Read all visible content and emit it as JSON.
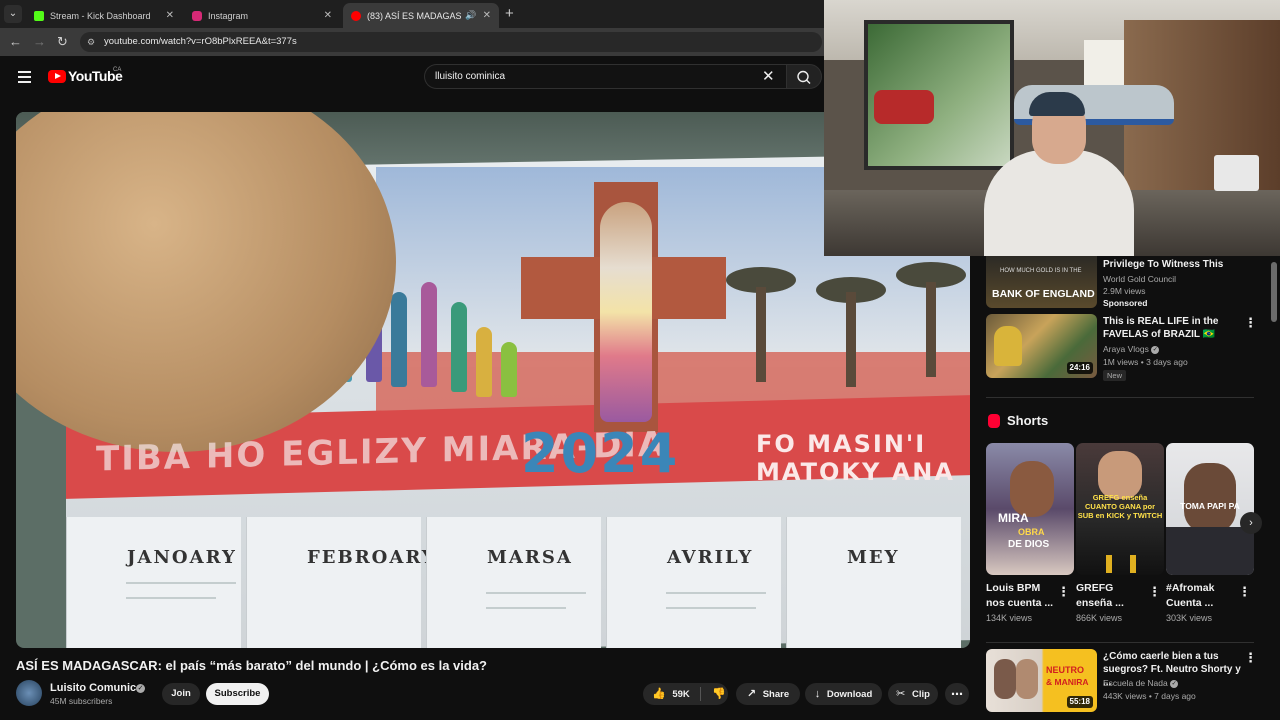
{
  "browser": {
    "tabs": [
      {
        "label": "Stream - Kick Dashboard",
        "color": "#53fc18"
      },
      {
        "label": "Instagram",
        "color": "#d62976"
      },
      {
        "label": "(83) ASÍ ES MADAGASCAR",
        "color": "#ff0000",
        "active": true
      }
    ],
    "url": "youtube.com/watch?v=rO8bPlxREEA&t=377s"
  },
  "youtube": {
    "logo_text": "YouTube",
    "region": "CA",
    "search_value": "lluisito cominica"
  },
  "video": {
    "calendar_texts": {
      "slogan": "TIBA HO EGLIZY MIARA-DIA",
      "year": "2024",
      "right_line1": "FO MASIN'I",
      "right_line2": "MATOKY ANA",
      "months": [
        "JANOARY",
        "FEBROARY",
        "MARSA",
        "AVRILY",
        "MEY"
      ]
    },
    "title": "ASÍ ES MADAGASCAR: el país “más barato” del mundo | ¿Cómo es la vida?",
    "channel": "Luisito Comunica",
    "subscribers": "45M subscribers",
    "join_label": "Join",
    "subscribe_label": "Subscribe",
    "likes": "59K",
    "share_label": "Share",
    "download_label": "Download",
    "clip_label": "Clip"
  },
  "sidebar": {
    "gold": {
      "thumb_line1": "HOW MUCH GOLD IS IN THE",
      "thumb_line2": "BANK OF ENGLAND",
      "title": "Privilege To Witness This",
      "channel": "World Gold Council",
      "views": "2.9M views",
      "sponsored": "Sponsored"
    },
    "brazil": {
      "title": "This is REAL LIFE in the FAVELAS of BRAZIL 🇧🇷",
      "channel": "Araya Vlogs",
      "meta": "1M views • 3 days ago",
      "badge": "New",
      "duration": "24:16"
    },
    "shorts_heading": "Shorts",
    "shorts": [
      {
        "title": "Louis BPM nos cuenta ...",
        "views": "134K views",
        "overlay1": "MIRA",
        "overlay2": "OBRA",
        "overlay3": "DE DIOS"
      },
      {
        "title": "GREFG enseña ...",
        "views": "866K views",
        "overlay1": "GREFG enseña",
        "overlay2": "CUANTO GANA por",
        "overlay3": "SUB en KICK y TWITCH"
      },
      {
        "title": "#Afromak Cuenta ...",
        "views": "303K views",
        "overlay1": "TOMA PAPI PA",
        "overlay2": "",
        "overlay3": ""
      }
    ],
    "neutro": {
      "title": "¿Cómo caerle bien a tus suegros? Ft. Neutro Shorty y ...",
      "channel": "Escuela de Nada",
      "meta": "443K views • 7 days ago",
      "duration": "55:18",
      "thumb_text1": "NEUTRO",
      "thumb_text2": "& MANIRA"
    }
  }
}
